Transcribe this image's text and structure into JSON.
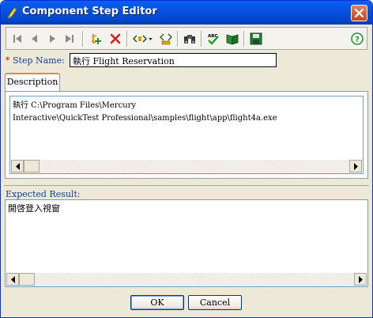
{
  "window": {
    "title": "Component Step Editor"
  },
  "toolbar": {
    "buttons": [
      {
        "name": "first-step",
        "icon": "first-icon"
      },
      {
        "name": "previous-step",
        "icon": "previous-icon"
      },
      {
        "name": "next-step",
        "icon": "next-icon"
      },
      {
        "name": "last-step",
        "icon": "last-icon"
      },
      {
        "name": "new-step",
        "icon": "new-step-icon"
      },
      {
        "name": "delete-step",
        "icon": "delete-icon"
      },
      {
        "name": "insert-parameter",
        "icon": "parameter-icon"
      },
      {
        "name": "parameterize",
        "icon": "parameterize-icon"
      },
      {
        "name": "find",
        "icon": "binoculars-icon"
      },
      {
        "name": "spell-check",
        "icon": "spellcheck-icon"
      },
      {
        "name": "open-book",
        "icon": "book-icon"
      },
      {
        "name": "save",
        "icon": "save-icon"
      },
      {
        "name": "help",
        "icon": "help-icon"
      }
    ]
  },
  "step_name": {
    "required_marker": "*",
    "label": "Step Name:",
    "value": "執行 Flight Reservation"
  },
  "tabs": [
    {
      "label": "Description",
      "active": true
    }
  ],
  "description": {
    "text": "執行 C:\\Program Files\\Mercury\nInteractive\\QuickTest Professional\\samples\\flight\\app\\flight4a.exe"
  },
  "expected_result": {
    "label": "Expected Result:",
    "text": "開啓登入視窗"
  },
  "buttons": {
    "ok": "OK",
    "cancel": "Cancel"
  },
  "colors": {
    "titlebar": "#0553e0",
    "window_bg": "#ece9d8",
    "delete_red": "#d42020",
    "spell_green": "#1e9a2c",
    "label_blue": "#1a3b8c"
  }
}
